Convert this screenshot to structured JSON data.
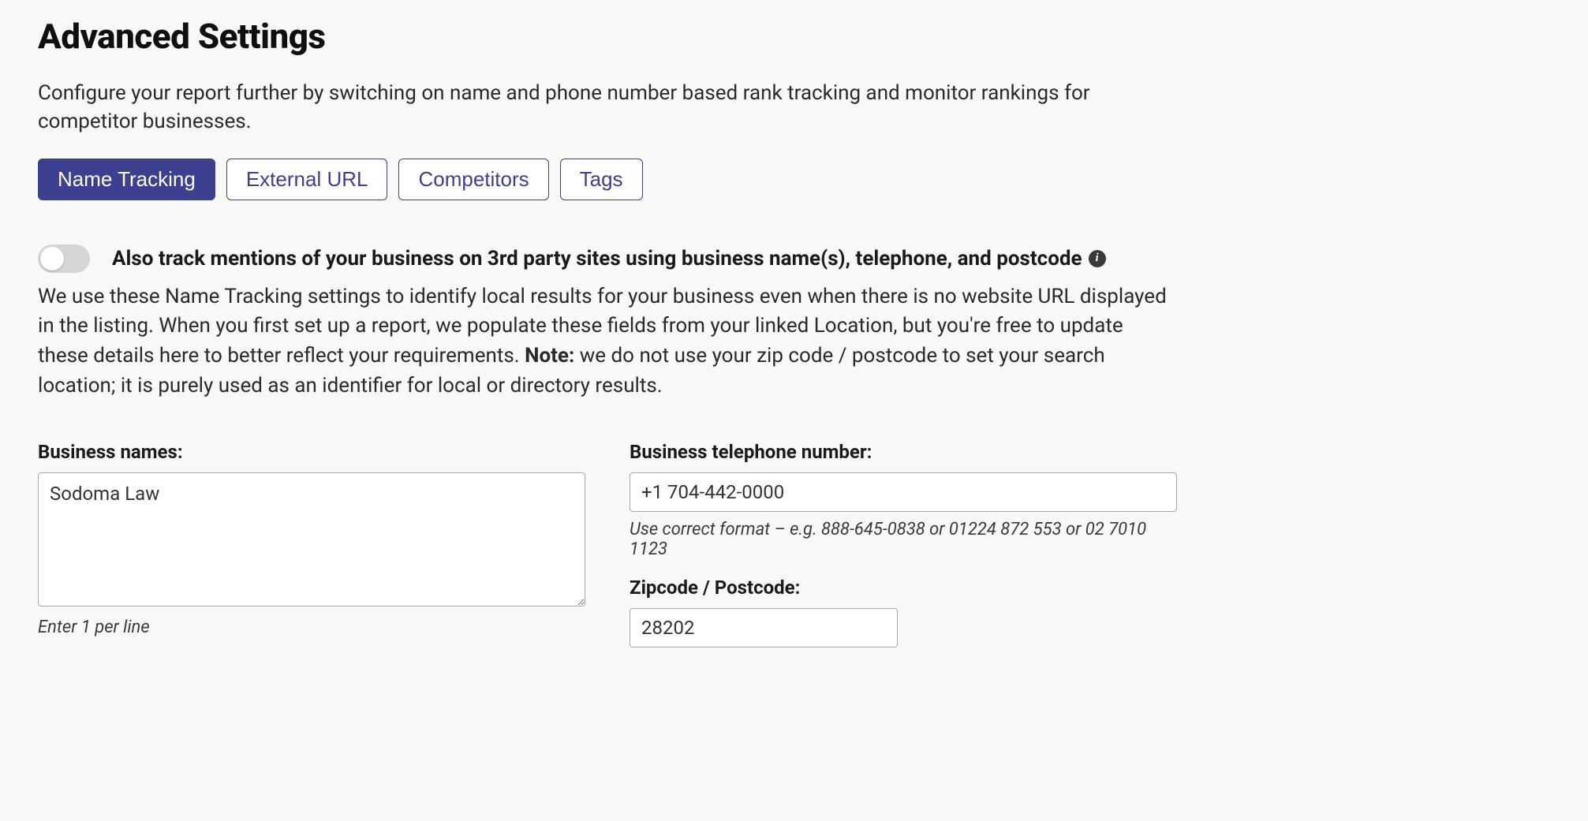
{
  "header": {
    "title": "Advanced Settings",
    "description": "Configure your report further by switching on name and phone number based rank tracking and monitor rankings for competitor businesses."
  },
  "tabs": [
    {
      "label": "Name Tracking",
      "active": true
    },
    {
      "label": "External URL",
      "active": false
    },
    {
      "label": "Competitors",
      "active": false
    },
    {
      "label": "Tags",
      "active": false
    }
  ],
  "toggle": {
    "label": "Also track mentions of your business on 3rd party sites using business name(s), telephone, and postcode",
    "on": false
  },
  "explanation": {
    "pre": "We use these Name Tracking settings to identify local results for your business even when there is no website URL displayed in the listing. When you first set up a report, we populate these fields from your linked Location, but you're free to update these details here to better reflect your requirements. ",
    "note_label": "Note:",
    "post": " we do not use your zip code / postcode to set your search location; it is purely used as an identifier for local or directory results."
  },
  "form": {
    "business_names": {
      "label": "Business names:",
      "value": "Sodoma Law",
      "hint": "Enter 1 per line"
    },
    "telephone": {
      "label": "Business telephone number:",
      "value": "+1 704-442-0000",
      "hint": "Use correct format – e.g. 888-645-0838 or 01224 872 553 or 02 7010 1123"
    },
    "zipcode": {
      "label": "Zipcode / Postcode:",
      "value": "28202"
    }
  }
}
